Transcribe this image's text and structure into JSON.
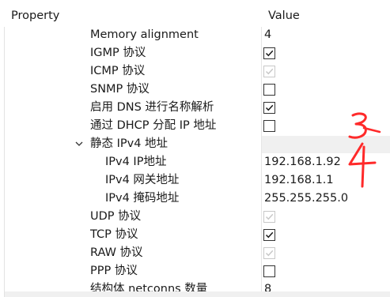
{
  "header": {
    "property_label": "Property",
    "value_label": "Value"
  },
  "rows": [
    {
      "name": "Memory alignment",
      "value": "4"
    },
    {
      "name": "IGMP 协议",
      "checkbox": "checked"
    },
    {
      "name": "ICMP 协议",
      "checkbox": "checked-disabled"
    },
    {
      "name": "SNMP 协议",
      "checkbox": "unchecked"
    },
    {
      "name": "启用 DNS 进行名称解析",
      "checkbox": "checked"
    },
    {
      "name": "通过 DHCP 分配 IP 地址",
      "checkbox": "unchecked"
    },
    {
      "name": "静态 IPv4 地址",
      "expanded": true
    },
    {
      "name": "IPv4 IP地址",
      "value": "192.168.1.92"
    },
    {
      "name": "IPv4 网关地址",
      "value": "192.168.1.1"
    },
    {
      "name": "IPv4 掩码地址",
      "value": "255.255.255.0"
    },
    {
      "name": "UDP 协议",
      "checkbox": "checked-disabled"
    },
    {
      "name": "TCP 协议",
      "checkbox": "checked"
    },
    {
      "name": "RAW 协议",
      "checkbox": "checked-disabled"
    },
    {
      "name": "PPP 协议",
      "checkbox": "unchecked"
    },
    {
      "name": "结构体 netconns 数量",
      "value": "8"
    }
  ],
  "annotation": {
    "handwritten_text": "3 → 4",
    "color": "#ff2a2a"
  },
  "colors": {
    "group_value_bg": "#f0f0f0",
    "check": "#1a1a1a",
    "check_disabled": "#c8c8c8"
  },
  "icons": {
    "expand": "chevron-down-icon",
    "check": "checkmark-icon"
  }
}
